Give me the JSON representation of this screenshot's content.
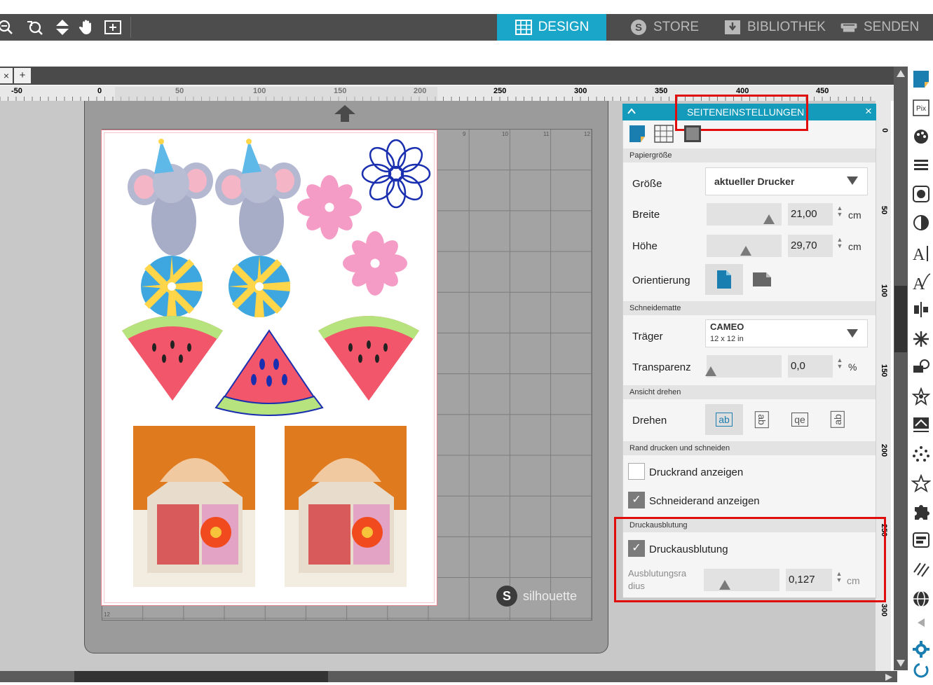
{
  "app": {
    "nav": {
      "design": "DESIGN",
      "store": "STORE",
      "library": "BIBLIOTHEK",
      "send": "SENDEN"
    },
    "toolbar_icons": [
      "zoom-out-icon",
      "zoom-select-icon",
      "pan-arrows-icon",
      "hand-icon",
      "fit-page-icon"
    ],
    "doc_tab": {
      "close": "×",
      "add": "+"
    }
  },
  "ruler": {
    "h_labels": [
      "-50",
      "0",
      "50",
      "100",
      "150",
      "200",
      "250",
      "300",
      "350",
      "400",
      "450"
    ],
    "v_labels": [
      "0",
      "50",
      "100",
      "150",
      "200",
      "250",
      "300"
    ]
  },
  "canvas": {
    "brand": "silhouette",
    "grid_numbers_top": [
      "9",
      "10",
      "11",
      "12"
    ],
    "grid_number_bottom": "12"
  },
  "panel": {
    "title": "SEITENEINSTELLUNGEN",
    "close": "×",
    "sections": {
      "paper_size": "Papiergröße",
      "cutting_mat": "Schneidematte",
      "rotate_view": "Ansicht drehen",
      "print_cut_border": "Rand drucken und schneiden",
      "print_bleed": "Druckausblutung"
    },
    "size": {
      "label": "Größe",
      "value": "aktueller Drucker"
    },
    "width": {
      "label": "Breite",
      "value": "21,00",
      "unit": "cm",
      "slider": 0.85
    },
    "height": {
      "label": "Höhe",
      "value": "29,70",
      "unit": "cm",
      "slider": 0.5
    },
    "orientation": {
      "label": "Orientierung"
    },
    "carrier": {
      "label": "Träger",
      "value": "CAMEO",
      "sub": "12 x 12 in"
    },
    "transparency": {
      "label": "Transparenz",
      "value": "0,0",
      "unit": "%",
      "slider": 0.0
    },
    "rotate": {
      "label": "Drehen",
      "options": [
        "ab",
        "ab",
        "qe",
        "ab"
      ]
    },
    "show_print_border": {
      "label": "Druckrand anzeigen",
      "checked": false
    },
    "show_cut_border": {
      "label": "Schneiderand anzeigen",
      "checked": true
    },
    "bleed": {
      "label": "Druckausblutung",
      "checked": true
    },
    "bleed_radius": {
      "label": "Ausblutungsra dius",
      "value": "0,127",
      "unit": "cm",
      "slider": 0.3
    }
  },
  "colors": {
    "accent": "#1aa6c8",
    "panel_head": "#149aba",
    "highlight_box": "#e00d0d"
  }
}
